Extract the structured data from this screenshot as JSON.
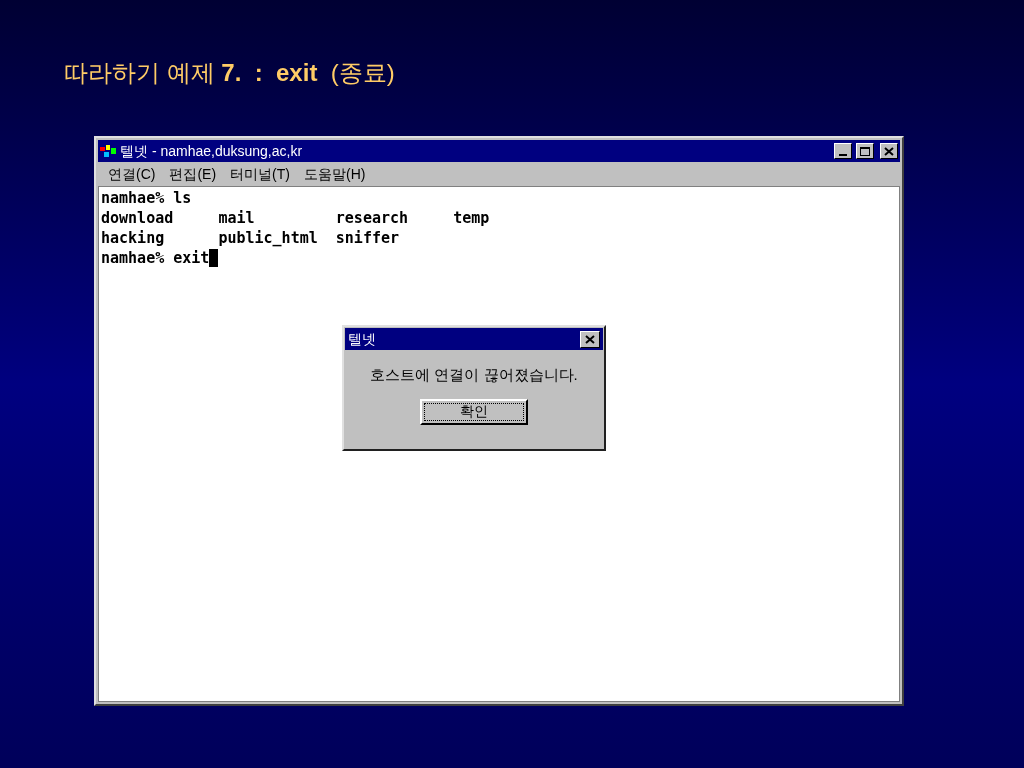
{
  "slide_title": "따라하기 예제 **7.  :  exit**  (종료)",
  "window": {
    "title": "텔넷 - namhae,duksung,ac,kr"
  },
  "menu": [
    "연결(C)",
    "편집(E)",
    "터미널(T)",
    "도움말(H)"
  ],
  "terminal_lines": [
    "namhae% ls",
    "download     mail         research     temp",
    "hacking      public_html  sniffer",
    "namhae% exit"
  ],
  "dialog": {
    "title": "텔넷",
    "message": "호스트에 연결이 끊어졌습니다.",
    "button": "확인"
  }
}
